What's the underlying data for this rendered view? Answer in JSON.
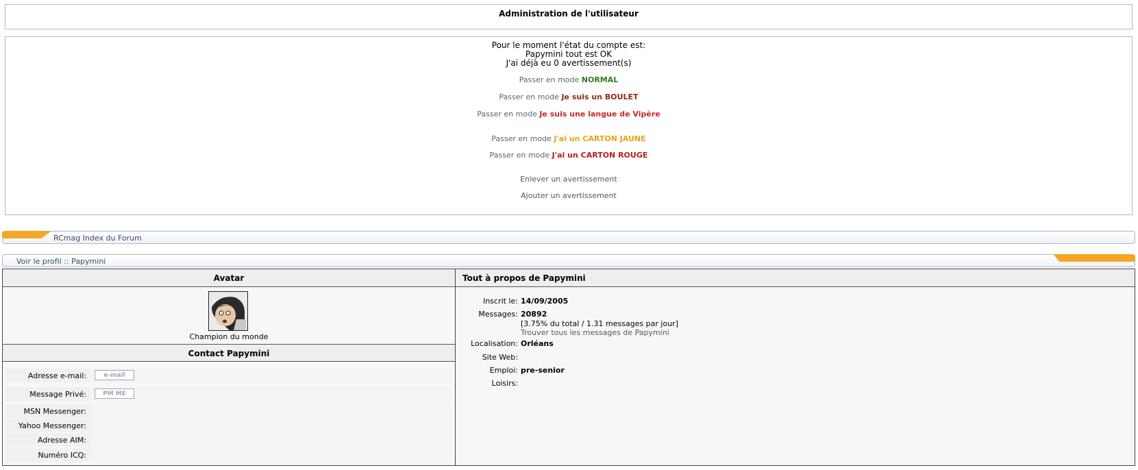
{
  "admin": {
    "title": "Administration de l'utilisateur",
    "status_line1": "Pour le moment l'état du compte est:",
    "status_line2": "Papymini tout est OK",
    "status_line3": "J'ai déjà eu 0 avertissement(s)",
    "mode_prefix": "Passer en mode",
    "modes": [
      {
        "label": "NORMAL",
        "color": "#2e7d1e"
      },
      {
        "label": "Je suis un BOULET",
        "color": "#8b2a1a"
      },
      {
        "label": "Je suis une langue de Vipère",
        "color": "#c62828"
      },
      {
        "label": "J'ai un CARTON JAUNE",
        "color": "#e8a317"
      },
      {
        "label": "J'ai un CARTON ROUGE",
        "color": "#c01818"
      }
    ],
    "remove_warning": "Enlever un avertissement",
    "add_warning": "Ajouter un avertissement"
  },
  "nav": {
    "index": "RCmag Index du Forum",
    "profile": "Voir le profil :: Papymini"
  },
  "colors": {
    "accent_orange": "#f5a623"
  },
  "profile": {
    "avatar_header": "Avatar",
    "rank": "Champion du monde",
    "contact_header": "Contact Papymini",
    "contact": {
      "email_label": "Adresse e-mail:",
      "email_button": "e-mail",
      "pm_label": "Message Privé:",
      "pm_button": "PM ME",
      "msn_label": "MSN Messenger:",
      "yahoo_label": "Yahoo Messenger:",
      "aim_label": "Adresse AIM:",
      "icq_label": "Numéro ICQ:"
    },
    "about_header": "Tout à propos de Papymini",
    "about": {
      "joined_label": "Inscrit le:",
      "joined_value": "14/09/2005",
      "posts_label": "Messages:",
      "posts_value": "20892",
      "posts_stats": "[3.75% du total / 1.31 messages par jour]",
      "posts_link": "Trouver tous les messages de Papymini",
      "location_label": "Localisation:",
      "location_value": "Orléans",
      "website_label": "Site Web:",
      "job_label": "Emploi:",
      "job_value": "pre-senior",
      "hobbies_label": "Loisirs:"
    }
  }
}
